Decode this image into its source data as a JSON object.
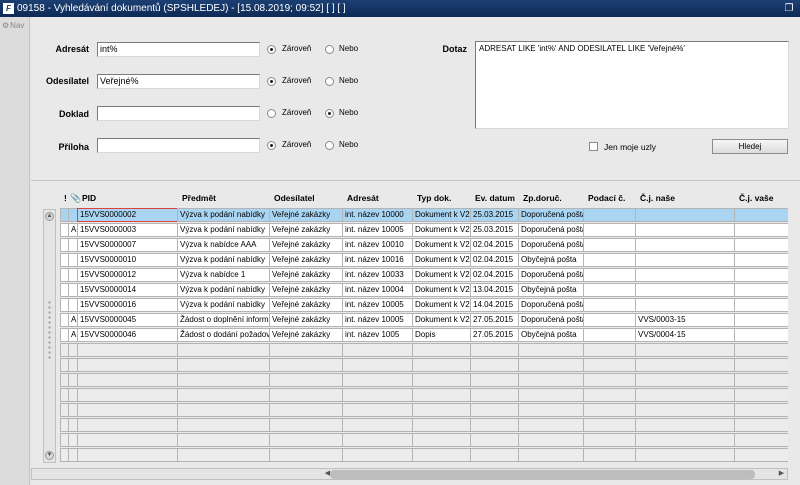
{
  "window": {
    "title": "09158 - Vyhledávání dokumentů (SPSHLEDEJ) - [15.08.2019; 09:52]  [ ]  [ ]",
    "app_icon": "F",
    "restore_icon": "restore-icon"
  },
  "nav": {
    "label": "Nav"
  },
  "form": {
    "adresat": {
      "label": "Adresát",
      "value": "int%",
      "opt1": "Zároveň",
      "opt2": "Nebo",
      "selected": "Zároveň"
    },
    "odesilatel": {
      "label": "Odesílatel",
      "value": "Veřejné%",
      "opt1": "Zároveň",
      "opt2": "Nebo",
      "selected": "Zároveň"
    },
    "doklad": {
      "label": "Doklad",
      "value": "",
      "opt1": "Zároveň",
      "opt2": "Nebo",
      "selected": "Nebo"
    },
    "priloha": {
      "label": "Příloha",
      "value": "",
      "opt1": "Zároveň",
      "opt2": "Nebo",
      "selected": "Zároveň"
    },
    "dotaz": {
      "label": "Dotaz",
      "value": "ADRESAT LIKE 'int%' AND ODESILATEL LIKE 'Veřejné%'"
    },
    "jen_moje": {
      "label": "Jen moje uzly",
      "checked": false
    },
    "hledej": {
      "label": "Hledej"
    }
  },
  "grid": {
    "headers": [
      "!",
      "PID",
      "Předmět",
      "Odesílatel",
      "Adresát",
      "Typ dok.",
      "Ev. datum",
      "Zp.doruč.",
      "Podací č.",
      "Č.j. naše",
      "Č.j. vaše"
    ],
    "rows": [
      {
        "flag": "",
        "pid": "15VVS0000002",
        "predmet": "Výzva k podání nabídky",
        "odesilatel": "Veřejné zakázky",
        "adresat": "int. název 10000",
        "typ": "Dokument k V2",
        "datum": "25.03.2015",
        "zpusob": "Doporučená pošta",
        "podaci": "",
        "cj_nase": "",
        "cj_vase": ""
      },
      {
        "flag": "A",
        "pid": "15VVS0000003",
        "predmet": "Výzva k podání nabídky",
        "odesilatel": "Veřejné zakázky",
        "adresat": "int. název 10005",
        "typ": "Dokument k V2",
        "datum": "25.03.2015",
        "zpusob": "Doporučená pošta",
        "podaci": "",
        "cj_nase": "",
        "cj_vase": ""
      },
      {
        "flag": "",
        "pid": "15VVS0000007",
        "predmet": "Výzva k nabídce AAA",
        "odesilatel": "Veřejné zakázky",
        "adresat": "int. název 10010",
        "typ": "Dokument k V2",
        "datum": "02.04.2015",
        "zpusob": "Doporučená pošta",
        "podaci": "",
        "cj_nase": "",
        "cj_vase": ""
      },
      {
        "flag": "",
        "pid": "15VVS0000010",
        "predmet": "Výzva k podání nabídky",
        "odesilatel": "Veřejné zakázky",
        "adresat": "int. název 10016",
        "typ": "Dokument k V2",
        "datum": "02.04.2015",
        "zpusob": "Obyčejná pošta",
        "podaci": "",
        "cj_nase": "",
        "cj_vase": ""
      },
      {
        "flag": "",
        "pid": "15VVS0000012",
        "predmet": "Výzva k nabídce 1",
        "odesilatel": "Veřejné zakázky",
        "adresat": "int. název 10033",
        "typ": "Dokument k V2",
        "datum": "02.04.2015",
        "zpusob": "Doporučená pošta",
        "podaci": "",
        "cj_nase": "",
        "cj_vase": ""
      },
      {
        "flag": "",
        "pid": "15VVS0000014",
        "predmet": "Výzva k podání nabídky",
        "odesilatel": "Veřejné zakázky",
        "adresat": "int. název 10004",
        "typ": "Dokument k V2",
        "datum": "13.04.2015",
        "zpusob": "Obyčejná pošta",
        "podaci": "",
        "cj_nase": "",
        "cj_vase": ""
      },
      {
        "flag": "",
        "pid": "15VVS0000016",
        "predmet": "Výzva k podání nabídky",
        "odesilatel": "Veřejné zakázky",
        "adresat": "int. název 10005",
        "typ": "Dokument k V2",
        "datum": "14.04.2015",
        "zpusob": "Doporučená pošta",
        "podaci": "",
        "cj_nase": "",
        "cj_vase": ""
      },
      {
        "flag": "A",
        "pid": "15VVS0000045",
        "predmet": "Žádost o doplnění informací",
        "odesilatel": "Veřejné zakázky",
        "adresat": "int. název 10005",
        "typ": "Dokument k V2",
        "datum": "27.05.2015",
        "zpusob": "Doporučená pošta",
        "podaci": "",
        "cj_nase": "VVS/0003-15",
        "cj_vase": ""
      },
      {
        "flag": "A",
        "pid": "15VVS0000046",
        "predmet": "Žádost o dodání požadovaných",
        "odesilatel": "Veřejné zakázky",
        "adresat": "int. název 1005",
        "typ": "Dopis",
        "datum": "27.05.2015",
        "zpusob": "Obyčejná pošta",
        "podaci": "",
        "cj_nase": "VVS/0004-15",
        "cj_vase": ""
      }
    ],
    "empty_rows": 8,
    "selected_row": 0
  }
}
